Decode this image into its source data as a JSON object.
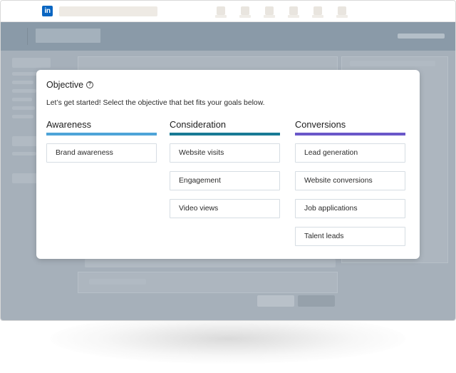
{
  "colors": {
    "awareness": "#4ea4d8",
    "consideration": "#187a95",
    "conversions": "#6a57c9",
    "brand": "#0a66c2"
  },
  "topbar": {
    "logo_icon": "linkedin-logo-icon"
  },
  "modal": {
    "title": "Objective",
    "help_icon": "help-circle-icon",
    "help_glyph": "?",
    "intro": "Let’s get started! Select the objective that bet fits your goals below.",
    "columns": [
      {
        "title": "Awareness",
        "options": [
          "Brand awareness"
        ]
      },
      {
        "title": "Consideration",
        "options": [
          "Website visits",
          "Engagement",
          "Video views"
        ]
      },
      {
        "title": "Conversions",
        "options": [
          "Lead generation",
          "Website conversions",
          "Job applications",
          "Talent leads"
        ]
      }
    ]
  }
}
